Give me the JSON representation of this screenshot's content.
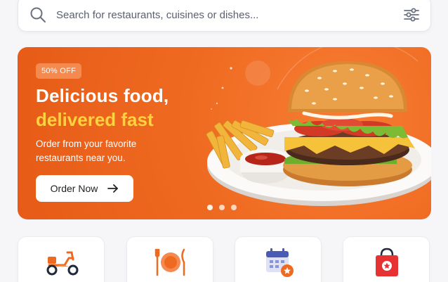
{
  "search": {
    "placeholder": "Search for restaurants, cuisines or dishes...",
    "search_icon": "search-icon",
    "filter_icon": "filter-sliders-icon"
  },
  "banner": {
    "badge": "50% OFF",
    "title_line1": "Delicious food,",
    "title_line2": "delivered fast",
    "subtitle": "Order from your favorite restaurants near you.",
    "cta_label": "Order Now",
    "cta_icon": "arrow-right-icon",
    "image": "burger-and-fries-plate",
    "carousel_total": 3,
    "carousel_active": 1
  },
  "categories": [
    {
      "icon": "scooter-delivery-icon"
    },
    {
      "icon": "plate-cutlery-icon"
    },
    {
      "icon": "calendar-star-icon"
    },
    {
      "icon": "shopping-bag-icon"
    }
  ],
  "colors": {
    "accent": "#ef6a21",
    "highlight": "#ffd23f",
    "background": "#f6f6f8"
  }
}
